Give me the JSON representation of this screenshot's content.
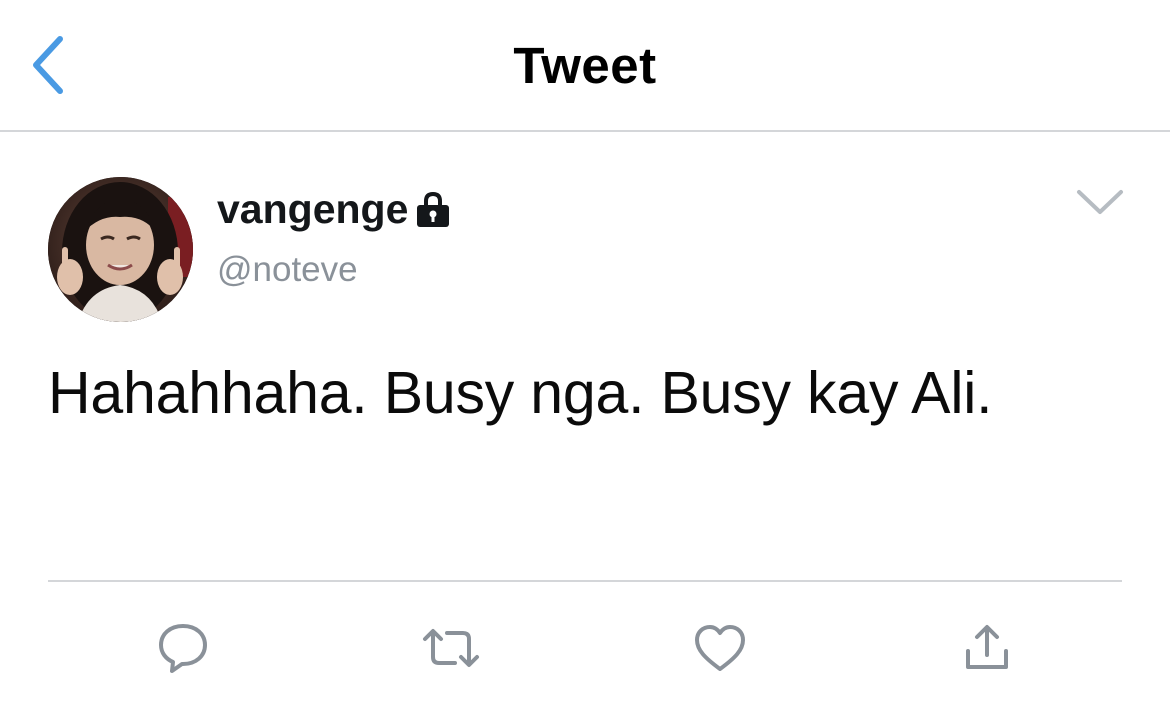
{
  "header": {
    "title": "Tweet",
    "back_icon": "chevron-left-icon",
    "accent_color": "#4a9ae3"
  },
  "tweet": {
    "author_name": "vangenge",
    "author_protected_icon": "lock-icon",
    "author_handle": "@noteve",
    "text": "Hahahhaha. Busy nga. Busy kay Ali.",
    "menu_icon": "chevron-down-icon"
  },
  "actions": [
    {
      "name": "reply",
      "icon": "reply-icon"
    },
    {
      "name": "retweet",
      "icon": "retweet-icon"
    },
    {
      "name": "like",
      "icon": "heart-icon"
    },
    {
      "name": "share",
      "icon": "share-icon"
    }
  ],
  "colors": {
    "text_primary": "#14171a",
    "text_secondary": "#8a9199",
    "icon_gray": "#8a9199",
    "divider": "#d4d6d9"
  }
}
